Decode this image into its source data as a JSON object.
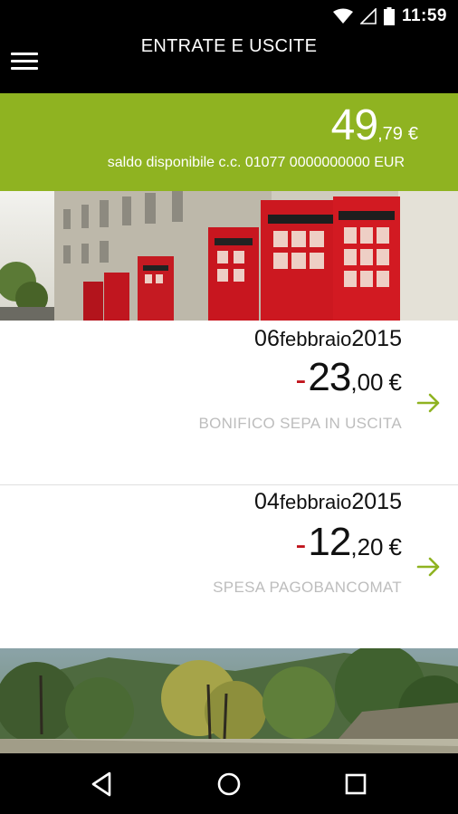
{
  "status_bar": {
    "time": "11:59",
    "icons": [
      "wifi-icon",
      "signal-icon",
      "battery-icon"
    ]
  },
  "app_bar": {
    "title": "ENTRATE E USCITE",
    "menu_icon": "hamburger-menu-icon"
  },
  "balance": {
    "integer": "49",
    "decimal": ",79",
    "currency": "€",
    "caption": "saldo disponibile c.c. 01077 0000000000 EUR",
    "background_color": "#8fb321"
  },
  "transactions": [
    {
      "date_day": "06",
      "date_month": "febbraio",
      "date_year": "2015",
      "sign": "-",
      "amount_integer": "23",
      "amount_decimal": ",00",
      "currency": "€",
      "description": "BONIFICO SEPA IN USCITA",
      "arrow_icon": "arrow-right-icon"
    },
    {
      "date_day": "04",
      "date_month": "febbraio",
      "date_year": "2015",
      "sign": "-",
      "amount_integer": "12",
      "amount_decimal": ",20",
      "currency": "€",
      "description": "SPESA PAGOBANCOMAT",
      "arrow_icon": "arrow-right-icon"
    }
  ],
  "colors": {
    "accent_green": "#8fb321",
    "negative_red": "#c0121a",
    "description_gray": "#bdbdbd"
  },
  "nav_bar": {
    "icons": [
      "back-icon",
      "home-icon",
      "recents-icon"
    ]
  }
}
